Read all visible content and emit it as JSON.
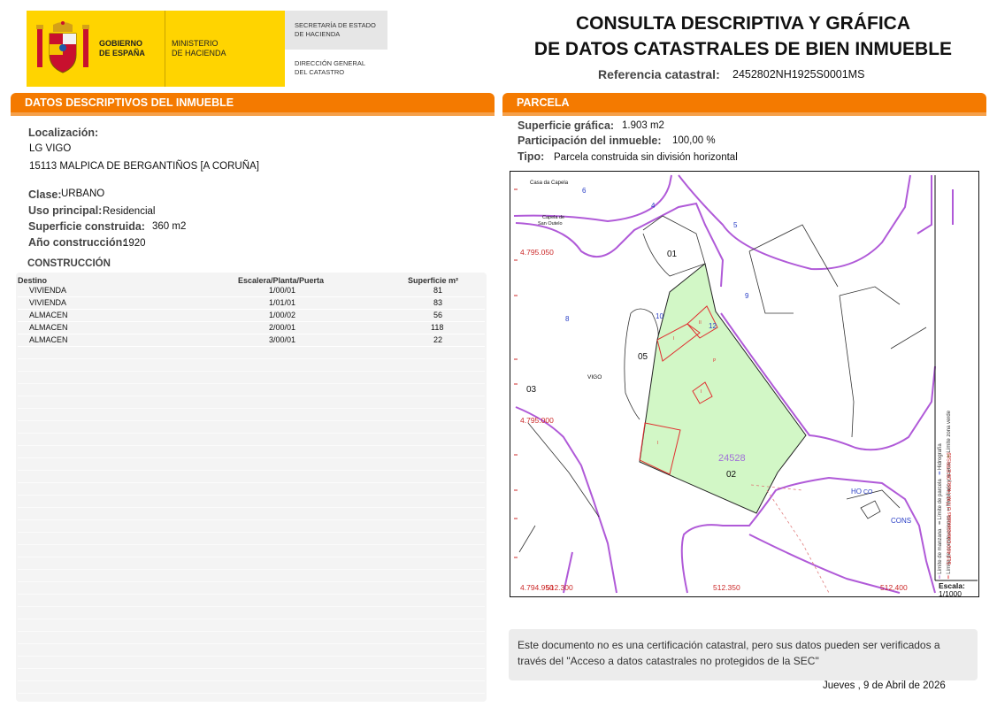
{
  "header": {
    "gobierno": "GOBIERNO\nDE ESPAÑA",
    "ministerio": "MINISTERIO\nDE HACIENDA",
    "secretaria": "SECRETARÍA DE ESTADO\nDE HACIENDA",
    "direccion": "DIRECCIÓN GENERAL\nDEL CATASTRO",
    "title_line1": "CONSULTA DESCRIPTIVA Y GRÁFICA",
    "title_line2": "DE DATOS CATASTRALES DE BIEN INMUEBLE",
    "ref_label": "Referencia catastral:",
    "ref_value": "2452802NH1925S0001MS"
  },
  "datos": {
    "section_title": "DATOS DESCRIPTIVOS DEL INMUEBLE",
    "localizacion_label": "Localización:",
    "localizacion_line1": "LG VIGO",
    "localizacion_line2": "15113 MALPICA DE BERGANTIÑOS [A CORUÑA]",
    "clase_label": "Clase:",
    "clase_value": "URBANO",
    "uso_label": "Uso principal:",
    "uso_value": "Residencial",
    "superficie_label": "Superficie construida:",
    "superficie_value": "360 m2",
    "anio_label": "Año construcción:",
    "anio_value": "1920",
    "construccion_title": "CONSTRUCCIÓN",
    "table_headers": [
      "Destino",
      "Escalera/Planta/Puerta",
      "Superficie m²"
    ],
    "rows": [
      {
        "destino": "VIVIENDA",
        "planta": "1/00/01",
        "superficie": "81"
      },
      {
        "destino": "VIVIENDA",
        "planta": "1/01/01",
        "superficie": "83"
      },
      {
        "destino": "ALMACEN",
        "planta": "1/00/02",
        "superficie": "56"
      },
      {
        "destino": "ALMACEN",
        "planta": "2/00/01",
        "superficie": "118"
      },
      {
        "destino": "ALMACEN",
        "planta": "3/00/01",
        "superficie": "22"
      }
    ]
  },
  "parcela": {
    "section_title": "PARCELA",
    "sup_grafica_label": "Superficie gráfica:",
    "sup_grafica_value": "1.903 m2",
    "participacion_label": "Participación del inmueble:",
    "participacion_value": "100,00 %",
    "tipo_label": "Tipo:",
    "tipo_value": "Parcela construida sin división horizontal"
  },
  "map": {
    "labels": {
      "casa_capela": "Casa da Capela",
      "capela_line1": "Capela de",
      "capela_line2": "San Outelo",
      "y1": "4.795.050",
      "y2": "4.795.000",
      "y3": "4.794.950",
      "x1": "512.300",
      "x2": "512.350",
      "x3": "512.400",
      "p01": "01",
      "p05": "05",
      "p03": "03",
      "p02": "02",
      "vigo": "VIGO",
      "parcel_ref": "24528",
      "n6": "6",
      "n4": "4",
      "n5": "5",
      "n9": "9",
      "n8": "8",
      "n10": "10",
      "n12": "12",
      "ho": "HO",
      "co": "CO",
      "cons": "CONS",
      "roman1": "I",
      "roman2": "II",
      "p_mark": "P"
    },
    "legend": {
      "limite_manzana": "Límite de manzana",
      "limite_parcela": "Límite de parcela",
      "limite_construcciones": "Límite de construcciones",
      "mobiliario": "Mobiliario y aceras",
      "limite_zona_verde": "Límite zona verde",
      "hidrografia": "Hidrografía",
      "coordenadas": "512.400 Coordenadas U.T.M. Huso 29 ETRS89"
    },
    "escala_label": "Escala:",
    "escala_value": "1/1000",
    "colors": {
      "manzana": "#b05ad8",
      "parcela_fill": "#d2f7c6",
      "construccion": "#e03030",
      "coords": "#cc2a2a",
      "numbers": "#2a3fc6"
    }
  },
  "notice": "Este documento no es una certificación catastral, pero sus datos pueden ser verificados a través del \"Acceso a datos catastrales no protegidos de la SEC\"",
  "fecha": "Jueves , 9 de Abril de 2026"
}
